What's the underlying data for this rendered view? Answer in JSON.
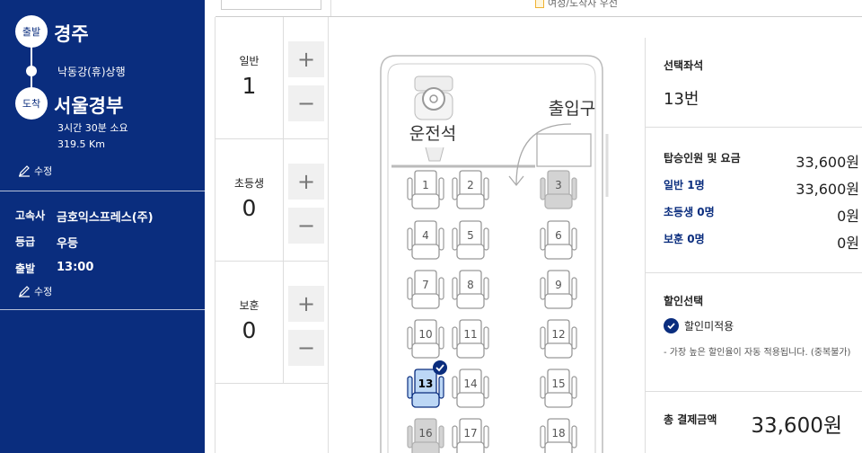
{
  "sidebar": {
    "departure_badge": "출발",
    "departure_city": "경주",
    "via": "낙동강(휴)상행",
    "arrival_badge": "도착",
    "arrival_city": "서울경부",
    "duration": "3시간 30분 소요",
    "distance": "319.5 Km",
    "edit_label_1": "수정",
    "company_key": "고속사",
    "company_value": "금호익스프레스(주)",
    "grade_key": "등급",
    "grade_value": "우등",
    "depart_key": "출발",
    "depart_value": "13:00",
    "edit_label_2": "수정"
  },
  "top": {
    "legend_text": "여성/도착자 우선"
  },
  "counters": [
    {
      "label": "일반",
      "count": "1",
      "plus": "+",
      "minus": "−"
    },
    {
      "label": "초등생",
      "count": "0",
      "plus": "+",
      "minus": "−"
    },
    {
      "label": "보훈",
      "count": "0",
      "plus": "+",
      "minus": "−"
    }
  ],
  "bus": {
    "driver_label": "운전석",
    "entrance_label": "출입구",
    "seats": [
      {
        "no": "1",
        "status": "available"
      },
      {
        "no": "2",
        "status": "available"
      },
      {
        "no": "3",
        "status": "sold"
      },
      {
        "no": "4",
        "status": "available"
      },
      {
        "no": "5",
        "status": "available"
      },
      {
        "no": "6",
        "status": "available"
      },
      {
        "no": "7",
        "status": "available"
      },
      {
        "no": "8",
        "status": "available"
      },
      {
        "no": "9",
        "status": "available"
      },
      {
        "no": "10",
        "status": "available"
      },
      {
        "no": "11",
        "status": "available"
      },
      {
        "no": "12",
        "status": "available"
      },
      {
        "no": "13",
        "status": "selected"
      },
      {
        "no": "14",
        "status": "available"
      },
      {
        "no": "15",
        "status": "available"
      },
      {
        "no": "16",
        "status": "sold"
      },
      {
        "no": "17",
        "status": "available"
      },
      {
        "no": "18",
        "status": "available"
      }
    ]
  },
  "summary": {
    "selected_title": "선택좌석",
    "selected_seat": "13번",
    "fare_title": "탑승인원 및 요금",
    "fare_total": "33,600원",
    "rows": [
      {
        "label": "일반 1명",
        "value": "33,600원"
      },
      {
        "label": "초등생 0명",
        "value": "0원"
      },
      {
        "label": "보훈 0명",
        "value": "0원"
      }
    ],
    "discount_title": "할인선택",
    "discount_option": "할인미적용",
    "discount_note": "- 가장 높은 할인율이 자동 적용됩니다. (중복불가)",
    "total_label": "총 결제금액",
    "total_value": "33,600원"
  },
  "colors": {
    "primary": "#0a2d7e",
    "selected_seat": "#bcd7f5",
    "sold_seat": "#d3d3d3"
  }
}
